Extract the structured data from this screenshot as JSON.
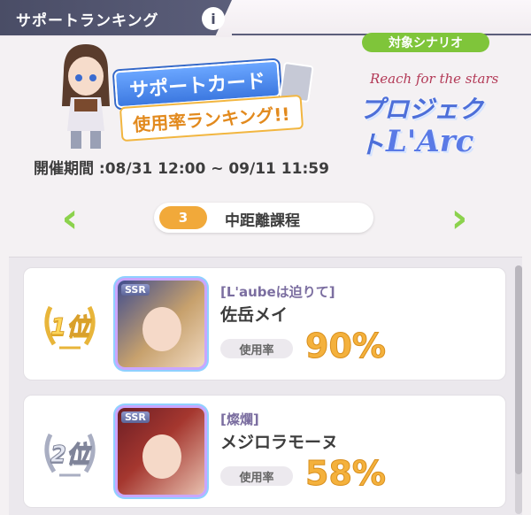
{
  "header": {
    "title": "サポートランキング",
    "info_label": "i"
  },
  "banner": {
    "title_line1": "サポートカード",
    "title_line2": "使用率ランキング!!",
    "scenario_badge": "対象シナリオ",
    "scenario_sub": "Reach for the stars",
    "scenario_name_1": "プロジェクト",
    "scenario_name_2": "L'Arc",
    "period": "開催期間 :08/31 12:00 ~ 09/11 11:59"
  },
  "category": {
    "number": "3",
    "name": "中距離課程",
    "prev_icon": "chevron-left-icon",
    "next_icon": "chevron-right-icon"
  },
  "rankings": [
    {
      "rank_label": "1位",
      "rarity": "SSR",
      "card_title": "[L'aubeは迫りて]",
      "character": "佐岳メイ",
      "usage_label": "使用率",
      "usage_value": "90%"
    },
    {
      "rank_label": "2位",
      "rarity": "SSR",
      "card_title": "[燦爛]",
      "character": "メジロラモーヌ",
      "usage_label": "使用率",
      "usage_value": "58%"
    }
  ],
  "colors": {
    "accent_green": "#8bd24c",
    "accent_orange": "#f1a93a",
    "header_dark": "#4a4d66",
    "usage_gold": "#f4b13c"
  }
}
